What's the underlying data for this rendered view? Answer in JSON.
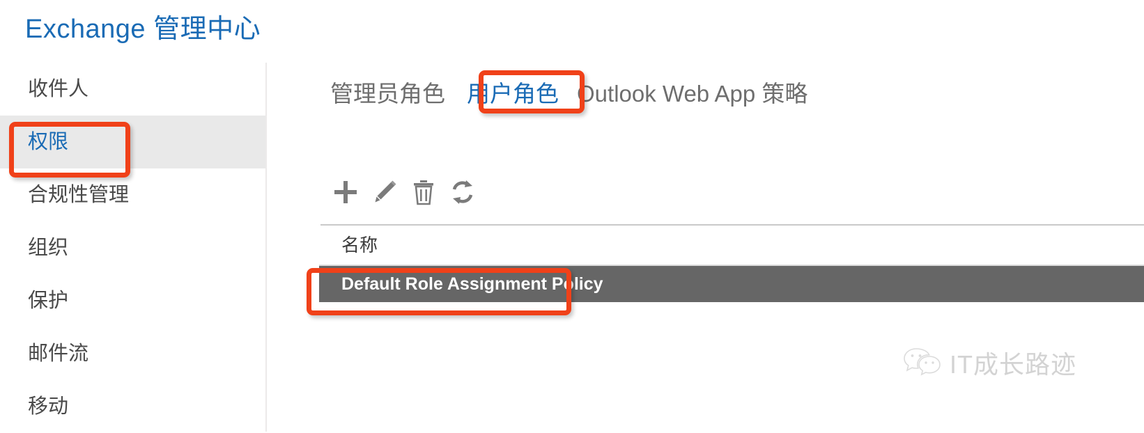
{
  "header": {
    "app_title": "Exchange 管理中心",
    "title_color": "#1a6bb5"
  },
  "sidebar": {
    "items": [
      {
        "label": "收件人",
        "selected": false
      },
      {
        "label": "权限",
        "selected": true
      },
      {
        "label": "合规性管理",
        "selected": false
      },
      {
        "label": "组织",
        "selected": false
      },
      {
        "label": "保护",
        "selected": false
      },
      {
        "label": "邮件流",
        "selected": false
      },
      {
        "label": "移动",
        "selected": false
      }
    ],
    "selected_bg": "#e9e9e9",
    "selected_color": "#1a6bb5"
  },
  "main": {
    "tabs": [
      {
        "label": "管理员角色",
        "active": false
      },
      {
        "label": "用户角色",
        "active": true
      },
      {
        "label": "Outlook Web App 策略",
        "active": false
      }
    ],
    "toolbar": {
      "add_label": "新增",
      "edit_label": "编辑",
      "delete_label": "删除",
      "refresh_label": "刷新",
      "icon_color": "#7b7b7b"
    },
    "table": {
      "columns": [
        "名称"
      ],
      "rows": [
        {
          "name": "Default Role Assignment Policy",
          "selected": true
        }
      ],
      "selected_row_bg": "#666666",
      "selected_row_color": "#ffffff"
    }
  },
  "annotations": {
    "color": "#f04119",
    "targets": [
      "sidebar-item-permissions",
      "tab-user-roles",
      "table-row-default-role-assignment-policy"
    ]
  },
  "watermark": {
    "text": "IT成长路迹",
    "icon": "wechat-icon",
    "color": "#b9b9b9"
  }
}
